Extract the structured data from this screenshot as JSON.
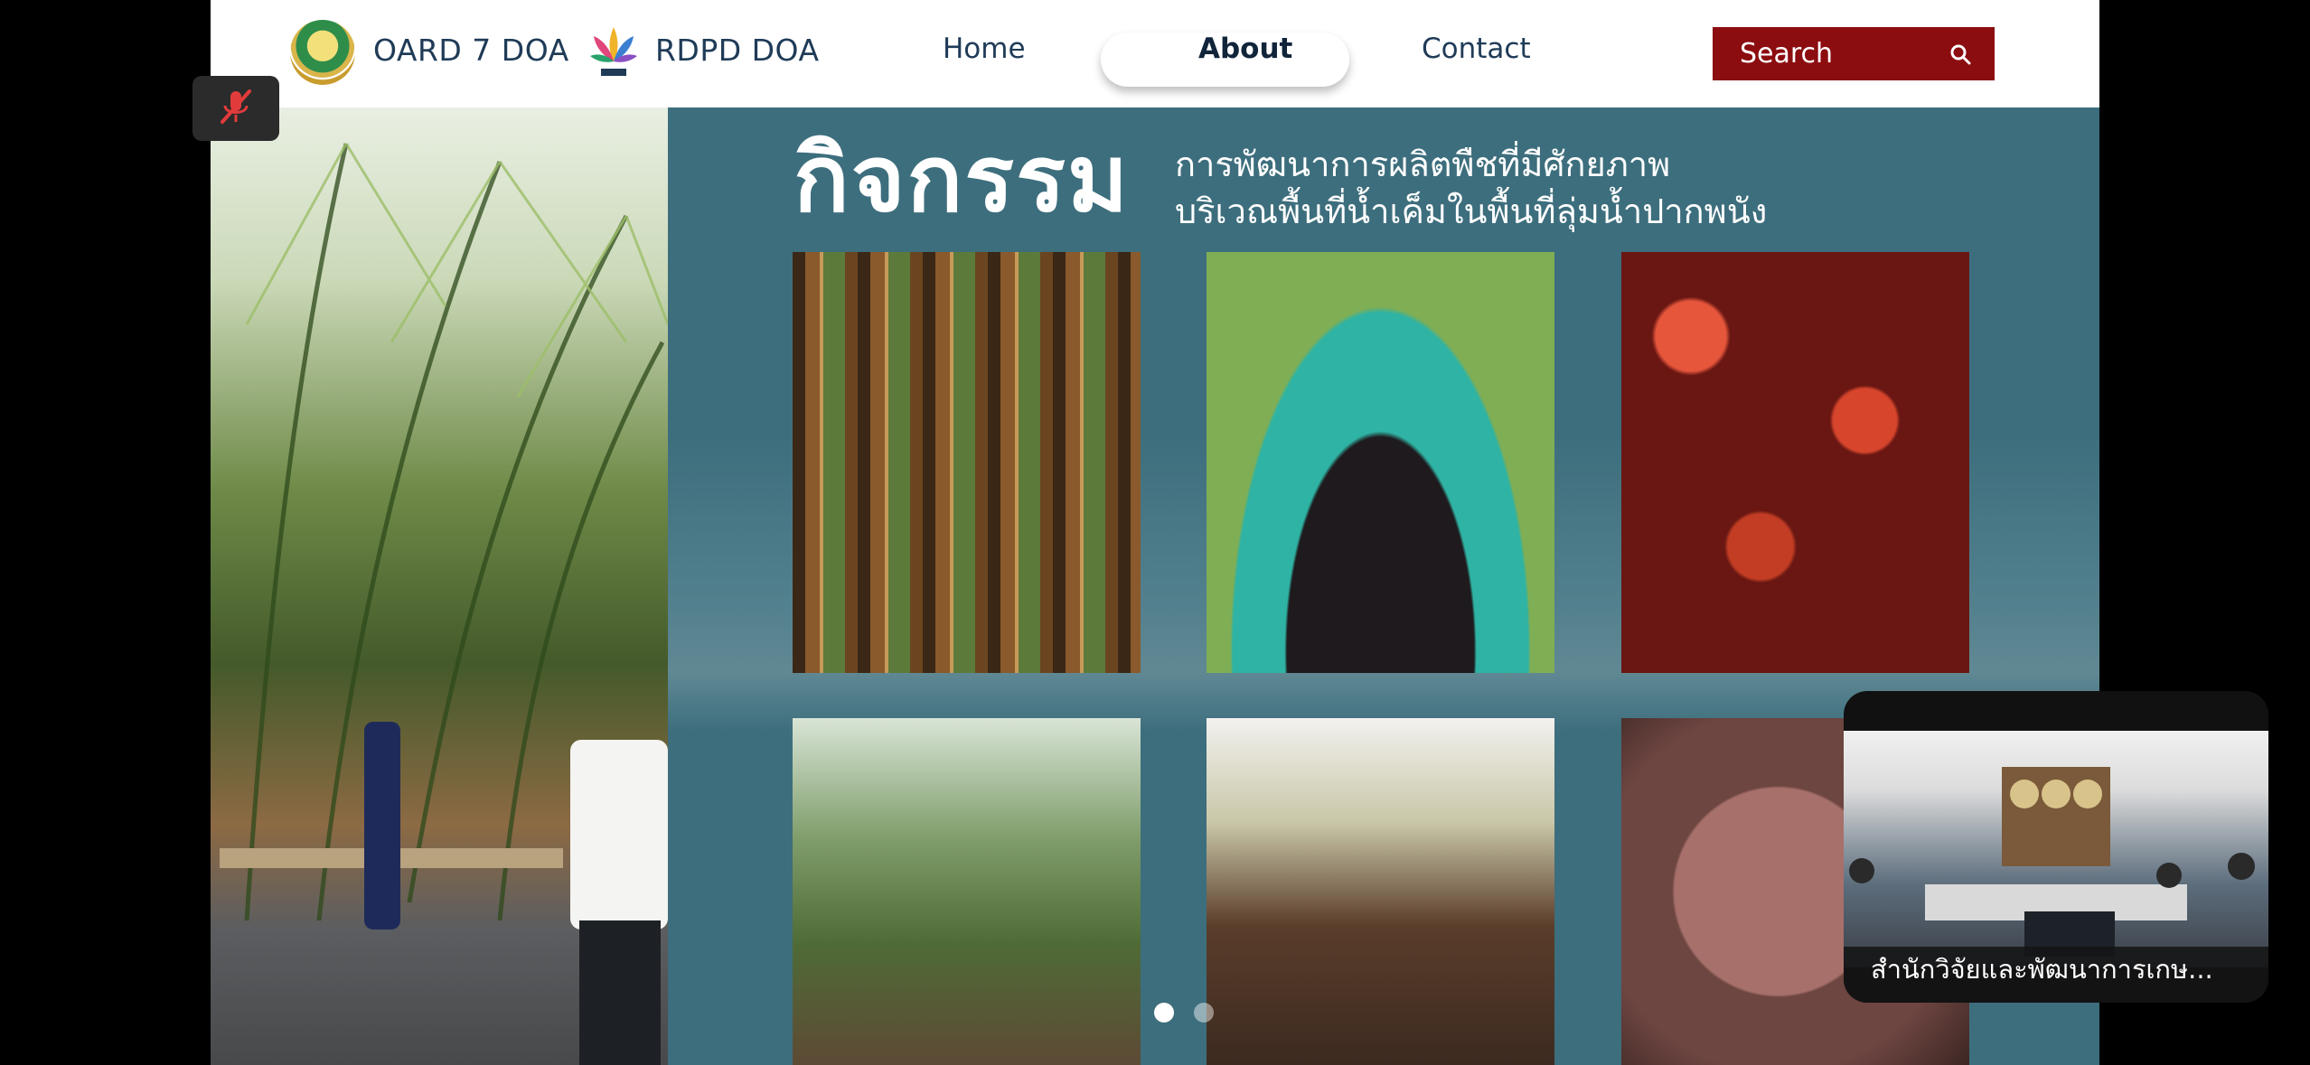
{
  "navbar": {
    "brand_left": "OARD 7 DOA",
    "brand_right": "RDPD DOA",
    "links": {
      "home": "Home",
      "about": "About",
      "contact": "Contact"
    },
    "search_label": "Search",
    "active_link": "About"
  },
  "hero": {
    "title": "กิจกรรม",
    "subtitle_line1": "การพัฒนาการผลิตพืชที่มีศักยภาพ",
    "subtitle_line2": "บริเวณพื้นที่น้ำเค็มในพื้นที่ลุ่มน้ำปากพนัง"
  },
  "slider": {
    "dot_count": 2,
    "active_index": 1
  },
  "video_tile": {
    "caption": "สำนักวิจัยและพัฒนาการเกษ..."
  },
  "colors": {
    "slide_background": "#3d6e7d",
    "search_bg": "#8c0d10",
    "nav_text": "#1f3b57"
  },
  "icons": [
    "search-icon",
    "mic-muted-icon",
    "oard-emblem-icon",
    "rdpd-emblem-icon"
  ]
}
